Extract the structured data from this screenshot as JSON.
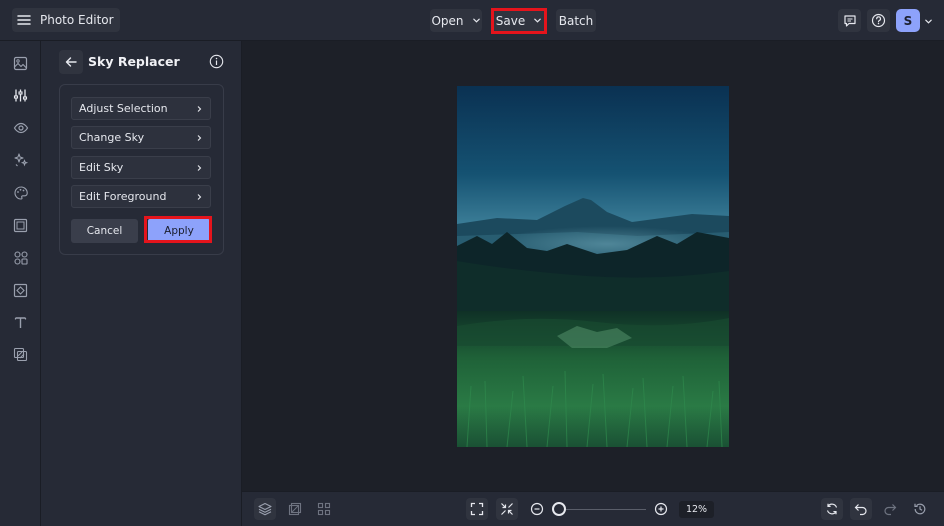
{
  "header": {
    "app_title": "Photo Editor",
    "open_label": "Open",
    "save_label": "Save",
    "batch_label": "Batch",
    "avatar_initial": "S"
  },
  "rail": {
    "icons": [
      "image-icon",
      "adjustments-icon",
      "eye-icon",
      "sparkles-icon",
      "palette-icon",
      "frame-icon",
      "shapes-icon",
      "texture-icon",
      "text-icon",
      "overlay-icon"
    ],
    "active_index": 1
  },
  "panel": {
    "title": "Sky Replacer",
    "items": [
      {
        "label": "Adjust Selection"
      },
      {
        "label": "Change Sky"
      },
      {
        "label": "Edit Sky"
      },
      {
        "label": "Edit Foreground"
      }
    ],
    "cancel_label": "Cancel",
    "apply_label": "Apply"
  },
  "bottombar": {
    "zoom_value": "12%",
    "zoom_percent": 12
  },
  "colors": {
    "accent": "#8da2fb",
    "highlight": "#e5141c",
    "background": "#1f222c"
  }
}
